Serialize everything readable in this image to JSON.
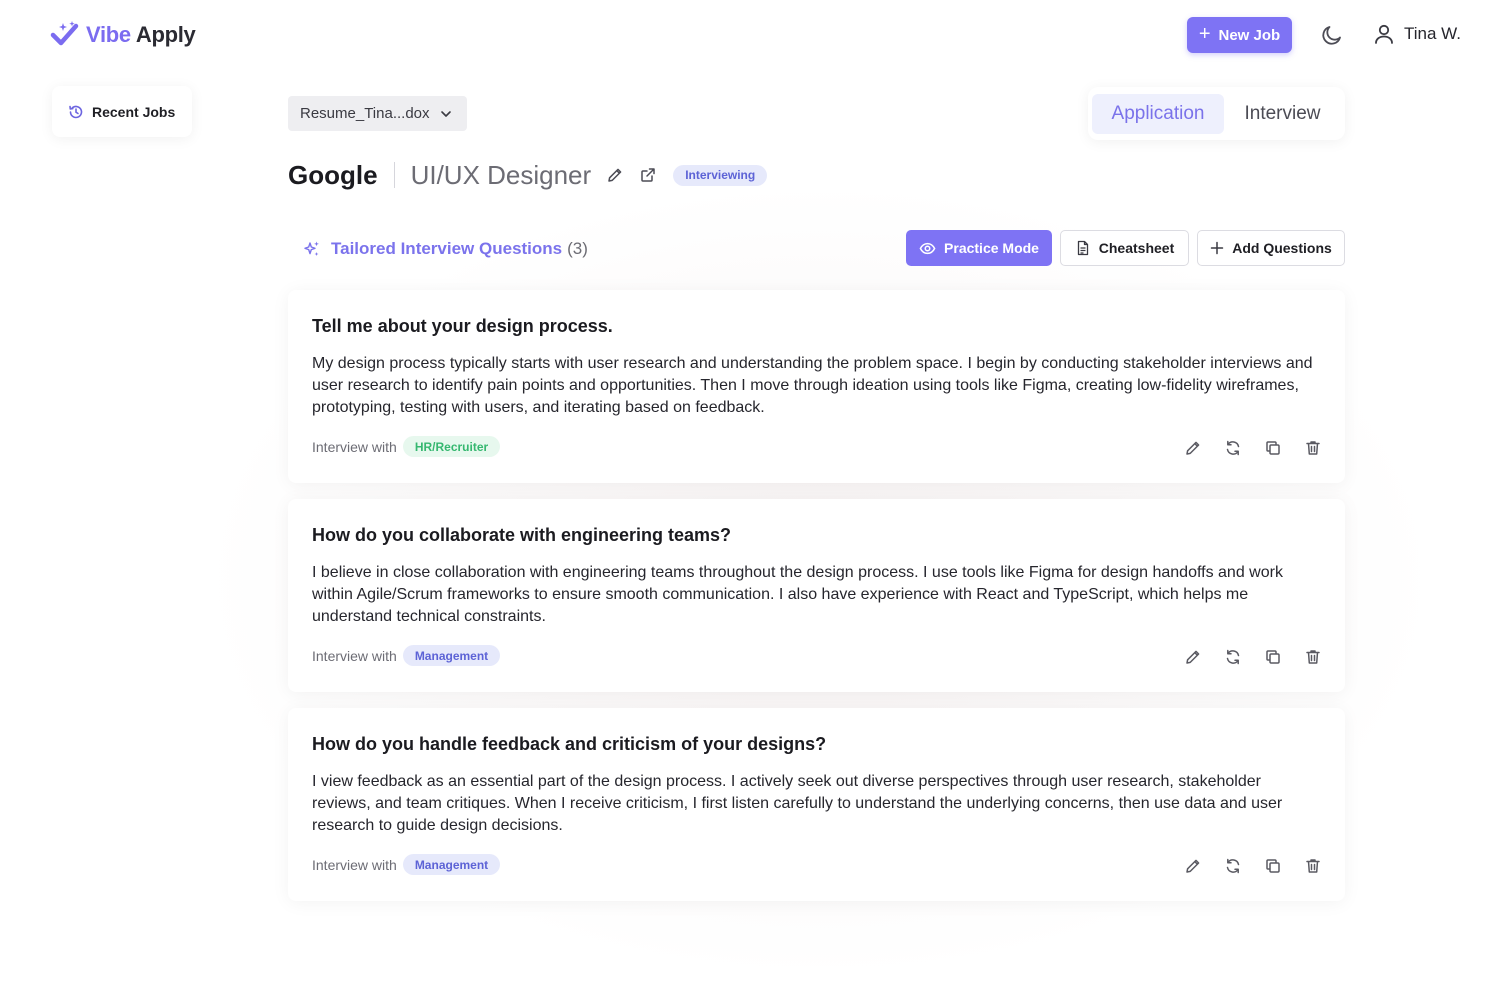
{
  "app": {
    "brand_part1": "Vibe",
    "brand_part2": "Apply"
  },
  "header": {
    "new_job_label": "New Job",
    "user_name": "Tina W."
  },
  "sidebar": {
    "recent_jobs_label": "Recent Jobs"
  },
  "resume_select": {
    "value": "Resume_Tina...dox"
  },
  "mode_tabs": [
    {
      "label": "Application",
      "active": true
    },
    {
      "label": "Interview",
      "active": false
    }
  ],
  "job": {
    "company": "Google",
    "role": "UI/UX Designer",
    "status": "Interviewing"
  },
  "section": {
    "title": "Tailored Interview Questions",
    "count": "(3)"
  },
  "toolbar": {
    "practice_label": "Practice Mode",
    "cheatsheet_label": "Cheatsheet",
    "add_questions_label": "Add Questions"
  },
  "questions": [
    {
      "question": "Tell me about your design process.",
      "answer": "My design process typically starts with user research and understanding the problem space. I begin by conducting stakeholder interviews and user research to identify pain points and opportunities. Then I move through ideation using tools like Figma, creating low-fidelity wireframes, prototyping, testing with users, and iterating based on feedback.",
      "interview_with_label": "Interview with",
      "interviewer": "HR/Recruiter"
    },
    {
      "question": "How do you collaborate with engineering teams?",
      "answer": "I believe in close collaboration with engineering teams throughout the design process. I use tools like Figma for design handoffs and work within Agile/Scrum frameworks to ensure smooth communication. I also have experience with React and TypeScript, which helps me understand technical constraints.",
      "interview_with_label": "Interview with",
      "interviewer": "Management"
    },
    {
      "question": "How do you handle feedback and criticism of your designs?",
      "answer": "I view feedback as an essential part of the design process. I actively seek out diverse perspectives through user research, stakeholder reviews, and team critiques. When I receive criticism, I first listen carefully to understand the underlying concerns, then use data and user research to guide design decisions.",
      "interview_with_label": "Interview with",
      "interviewer": "Management"
    }
  ],
  "colors": {
    "accent": "#7e73f4",
    "badge_blue_bg": "#e6e9fb",
    "badge_green_bg": "#e7f8ee"
  }
}
